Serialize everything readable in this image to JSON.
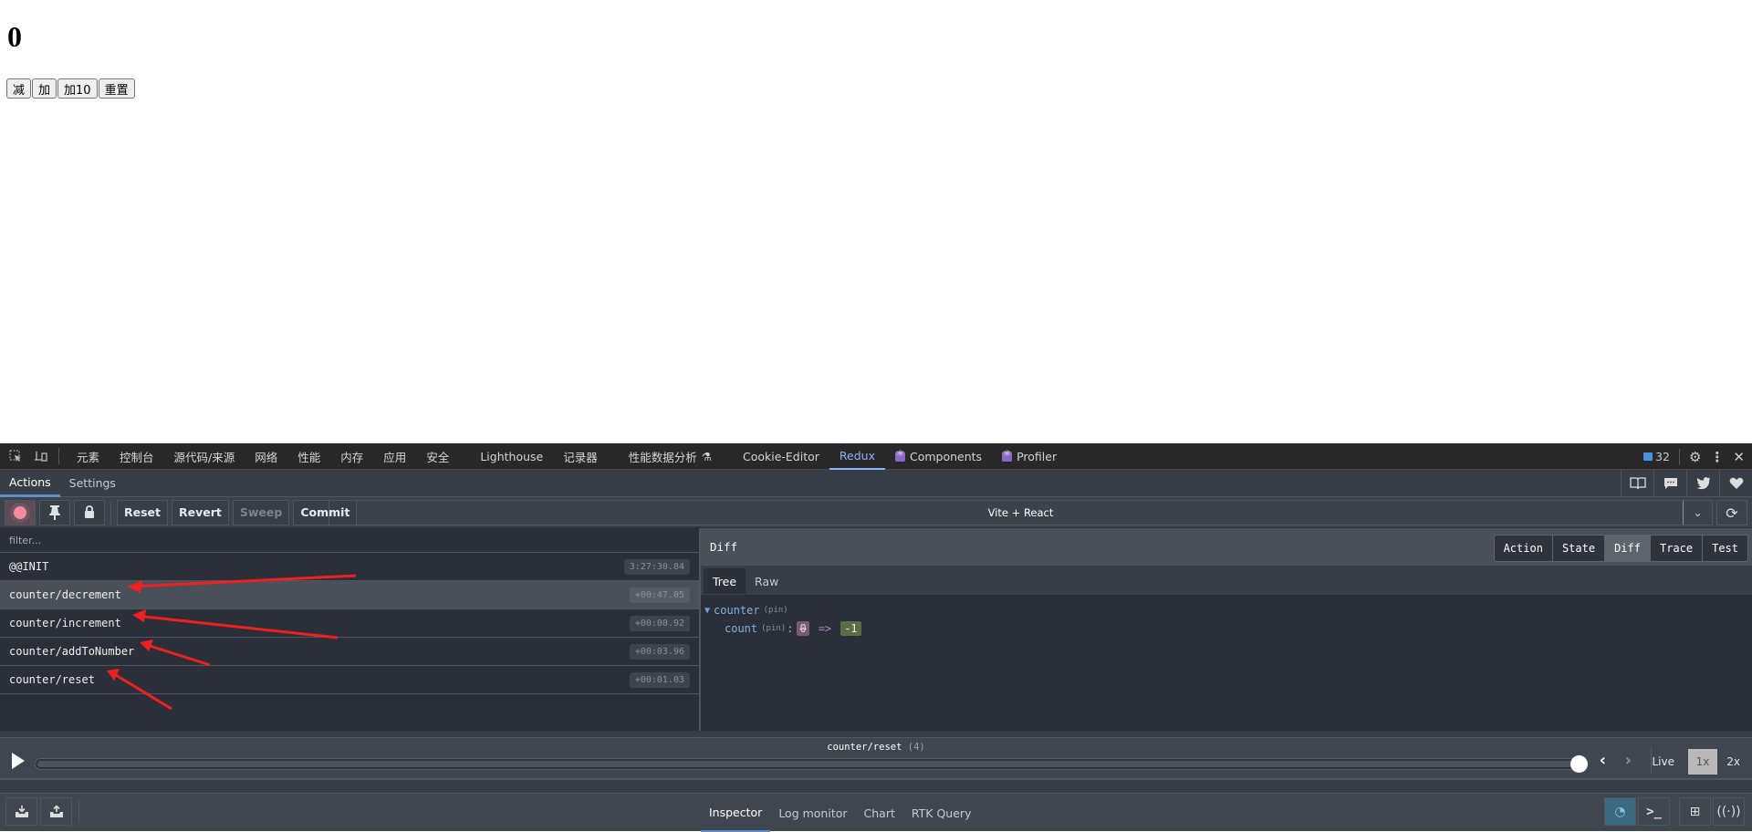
{
  "page": {
    "counter_value": "0",
    "buttons": [
      "减",
      "加",
      "加10",
      "重置"
    ]
  },
  "devtools": {
    "tabs": [
      "元素",
      "控制台",
      "源代码/来源",
      "网络",
      "性能",
      "内存",
      "应用",
      "安全",
      "Lighthouse",
      "记录器",
      "性能数据分析",
      "Cookie-Editor",
      "Redux",
      "Components",
      "Profiler"
    ],
    "active_tab": "Redux",
    "message_count": "32"
  },
  "redux": {
    "header_tabs": [
      "Actions",
      "Settings"
    ],
    "toolbar": {
      "reset": "Reset",
      "revert": "Revert",
      "sweep": "Sweep",
      "commit": "Commit",
      "instance": "Vite + React"
    },
    "filter_placeholder": "filter...",
    "actions": [
      {
        "type": "@@INIT",
        "time": "3:27:30.84"
      },
      {
        "type": "counter/decrement",
        "time": "+00:47.05",
        "selected": true
      },
      {
        "type": "counter/increment",
        "time": "+00:00.92"
      },
      {
        "type": "counter/addToNumber",
        "time": "+00:03.96"
      },
      {
        "type": "counter/reset",
        "time": "+00:01.03"
      }
    ],
    "diff": {
      "title": "Diff",
      "tabs": [
        "Action",
        "State",
        "Diff",
        "Trace",
        "Test"
      ],
      "active_tab": "Diff",
      "subtabs": [
        "Tree",
        "Raw"
      ],
      "tree": {
        "root_key": "counter",
        "pin": "(pin)",
        "child_key": "count",
        "old_value": "0",
        "operator": "=>",
        "new_value": "-1"
      }
    },
    "slider": {
      "label": "counter/reset",
      "index": "(4)",
      "position_fraction": 1.0,
      "speeds": [
        "Live",
        "1x",
        "2x"
      ],
      "active_speed": "1x"
    },
    "monitors": [
      "Inspector",
      "Log monitor",
      "Chart",
      "RTK Query"
    ],
    "active_monitor": "Inspector"
  }
}
